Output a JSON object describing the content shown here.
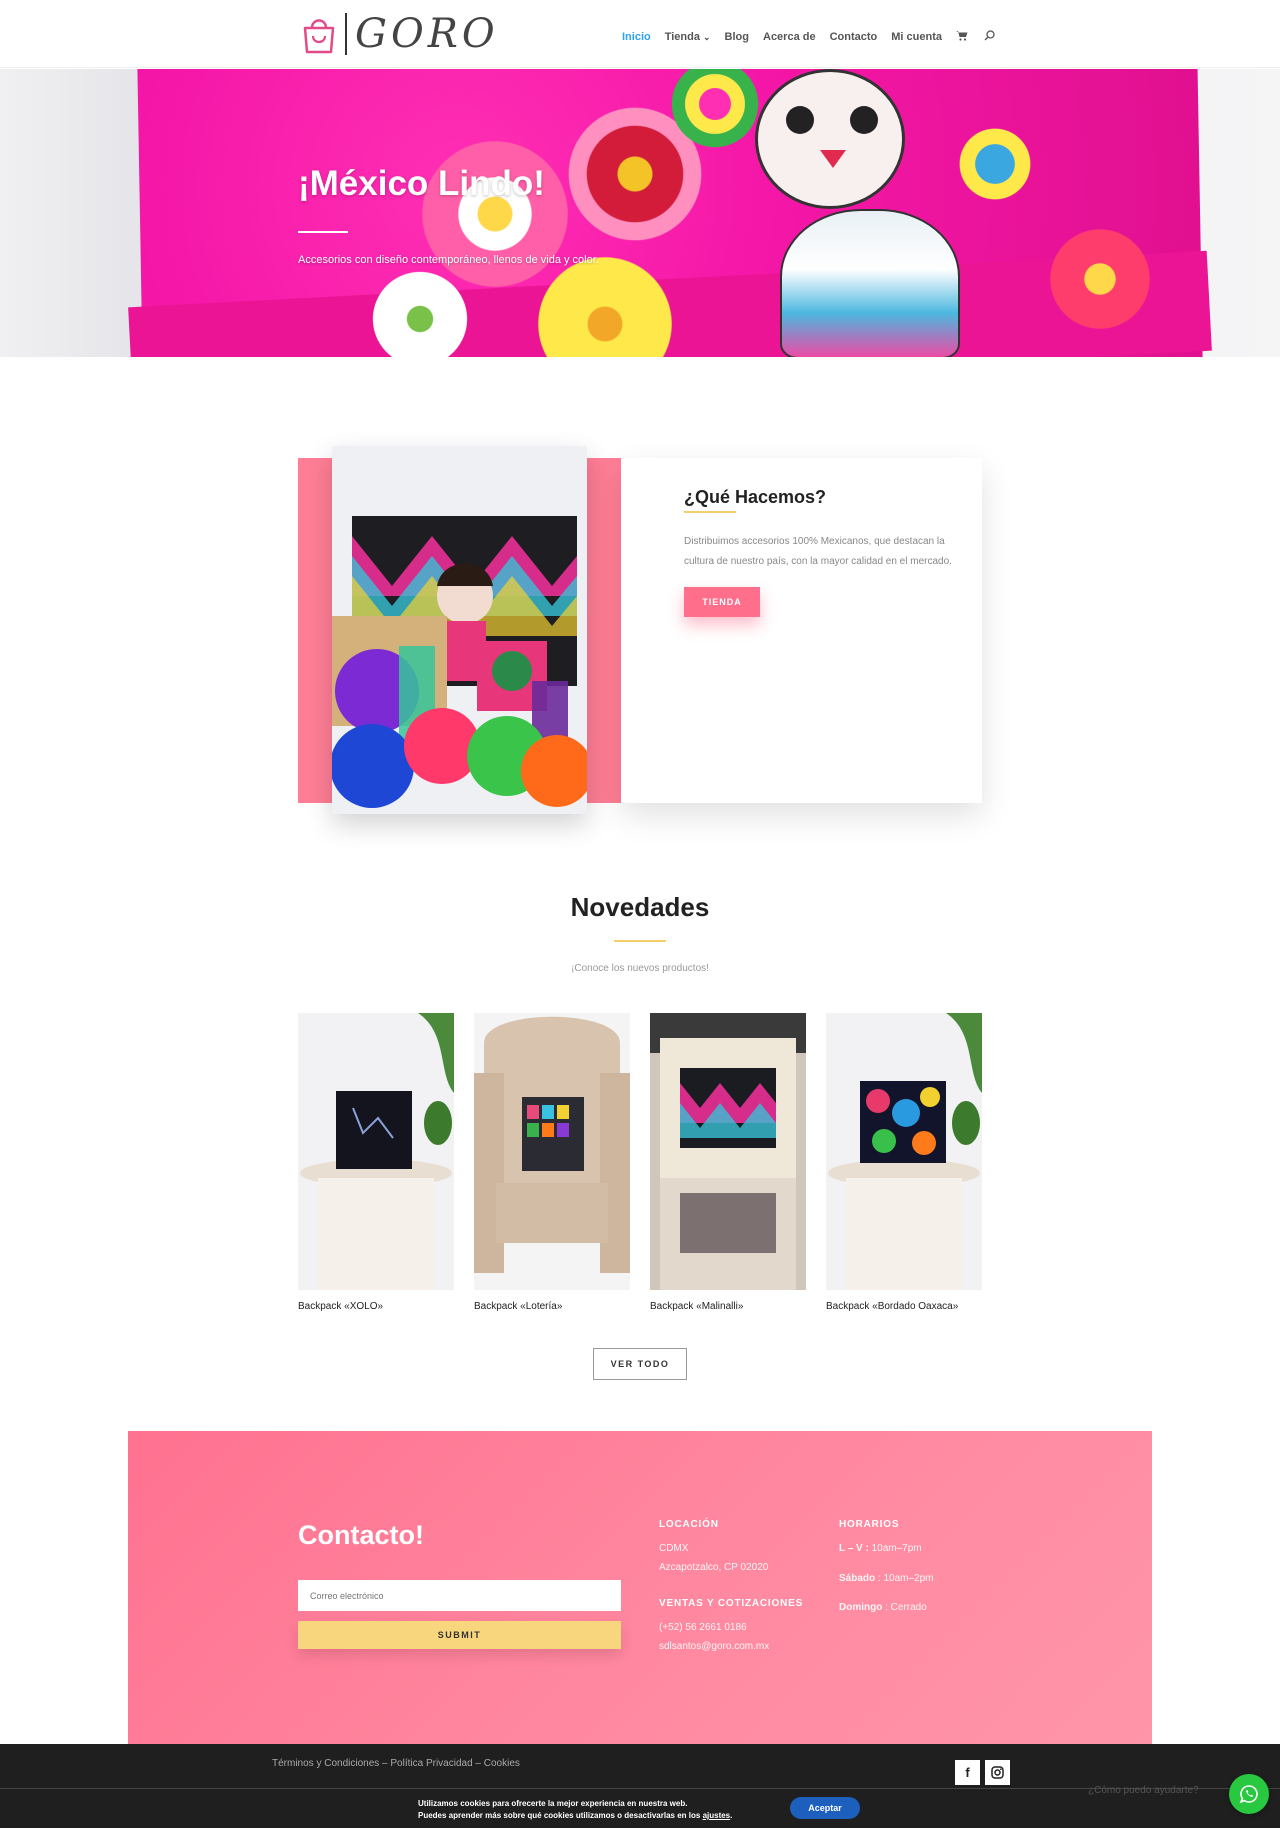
{
  "header": {
    "logo_text": "GORO",
    "nav": [
      {
        "label": "Inicio",
        "active": true
      },
      {
        "label": "Tienda",
        "dropdown": true
      },
      {
        "label": "Blog"
      },
      {
        "label": "Acerca de"
      },
      {
        "label": "Contacto"
      },
      {
        "label": "Mi cuenta"
      }
    ],
    "cart_icon": "cart-icon",
    "search_icon": "search-icon"
  },
  "hero": {
    "title": "¡México Lindo!",
    "subtitle": "Accesorios con diseño contemporáneo, llenos de vida y color."
  },
  "about": {
    "title": "¿Qué Hacemos?",
    "text": "Distribuimos accesorios 100% Mexicanos, que destacan la cultura de nuestro país, con la mayor calidad en el mercado.",
    "button": "TIENDA"
  },
  "novedades": {
    "title": "Novedades",
    "subtitle": "¡Conoce los nuevos productos!",
    "products": [
      {
        "name": "Backpack «XOLO»"
      },
      {
        "name": "Backpack «Lotería»"
      },
      {
        "name": "Backpack «Malinalli»"
      },
      {
        "name": "Backpack «Bordado Oaxaca»"
      }
    ],
    "button": "VER TODO"
  },
  "contact": {
    "title": "Contacto!",
    "email_placeholder": "Correo electrónico",
    "submit": "SUBMIT",
    "location_head": "LOCACIÓN",
    "location_lines": [
      "CDMX",
      "Azcapotzalco, CP 02020"
    ],
    "sales_head": "VENTAS Y COTIZACIONES",
    "sales_lines": [
      "(+52) 56 2661 0186",
      "sdlsantos@goro.com.mx"
    ],
    "hours_head": "HORARIOS",
    "hours": [
      {
        "day": "L – V :",
        "time": " 10am–7pm"
      },
      {
        "day": "Sábado",
        "time": " : 10am–2pm"
      },
      {
        "day": "Domingo",
        "time": " : Cerrado"
      }
    ]
  },
  "footer": {
    "links": "Términos y Condiciones – Política Privacidad – Cookies",
    "social": [
      "facebook-icon",
      "instagram-icon"
    ]
  },
  "cookie": {
    "line1": "Utilizamos cookies para ofrecerte la mejor experiencia en nuestra web.",
    "line2_prefix": "Puedes aprender más sobre qué cookies utilizamos o desactivarlas en los ",
    "line2_link": "ajustes",
    "line2_suffix": ".",
    "accept": "Aceptar"
  },
  "whatsapp": {
    "help": "¿Cómo puedo ayudarte?"
  },
  "colors": {
    "accent_blue": "#2ea3f2",
    "pink": "#ff7e96",
    "gold": "#f2cf6b",
    "whatsapp": "#28c840"
  }
}
